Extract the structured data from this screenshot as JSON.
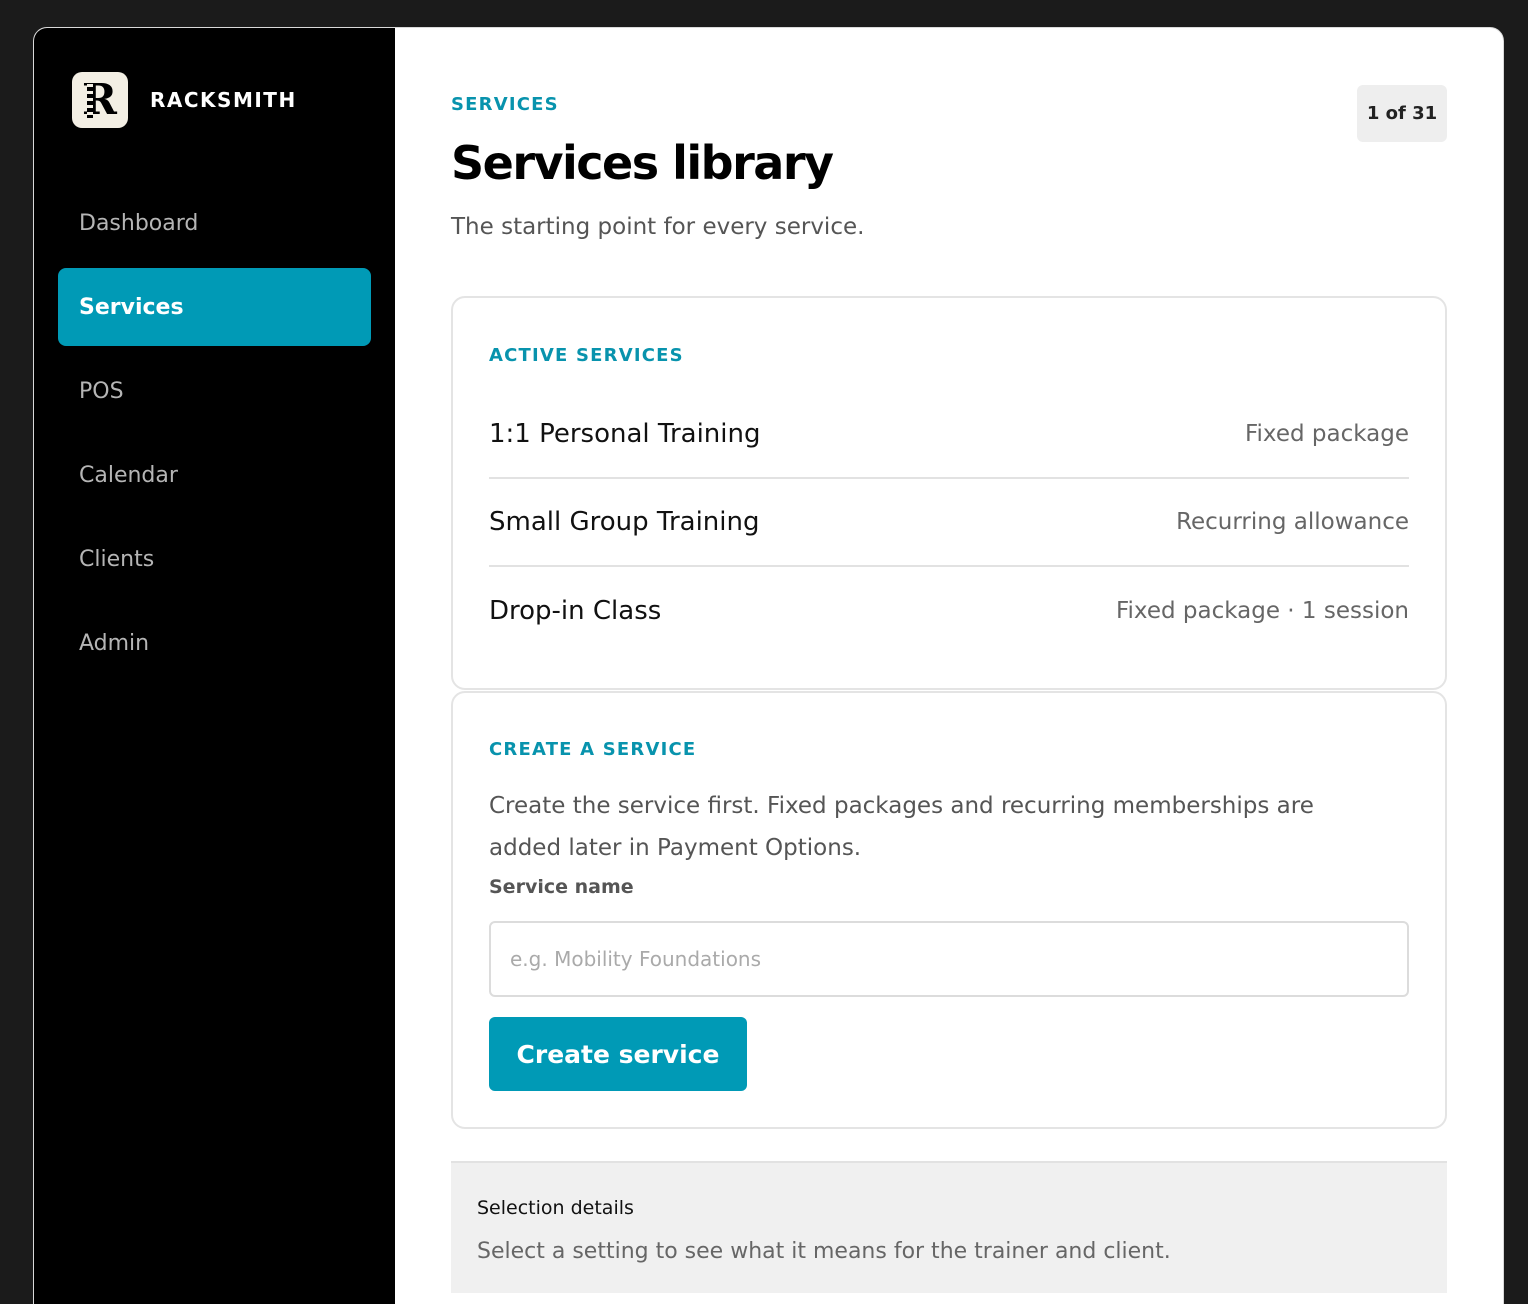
{
  "brand": {
    "name": "RACKSMITH",
    "logo_letter": "R"
  },
  "sidebar": {
    "items": [
      {
        "label": "Dashboard",
        "active": false
      },
      {
        "label": "Services",
        "active": true
      },
      {
        "label": "POS",
        "active": false
      },
      {
        "label": "Calendar",
        "active": false
      },
      {
        "label": "Clients",
        "active": false
      },
      {
        "label": "Admin",
        "active": false
      }
    ]
  },
  "header": {
    "eyebrow": "SERVICES",
    "title": "Services library",
    "subtitle": "The starting point for every service.",
    "counter": "1 of 31"
  },
  "active_services": {
    "heading": "ACTIVE SERVICES",
    "items": [
      {
        "name": "1:1 Personal Training",
        "type": "Fixed package"
      },
      {
        "name": "Small Group Training",
        "type": "Recurring allowance"
      },
      {
        "name": "Drop-in Class",
        "type": "Fixed package · 1 session"
      }
    ]
  },
  "create_service": {
    "heading": "CREATE A SERVICE",
    "description": "Create the service first. Fixed packages and recurring memberships are added later in Payment Options.",
    "field_label": "Service name",
    "field_value": "",
    "field_placeholder": "e.g. Mobility Foundations",
    "button_label": "Create service"
  },
  "selection_details": {
    "title": "Selection details",
    "text": "Select a setting to see what it means for the trainer and client."
  },
  "colors": {
    "accent": "#009ab6",
    "sidebar_bg": "#000000",
    "page_bg": "#1b1b1b"
  }
}
